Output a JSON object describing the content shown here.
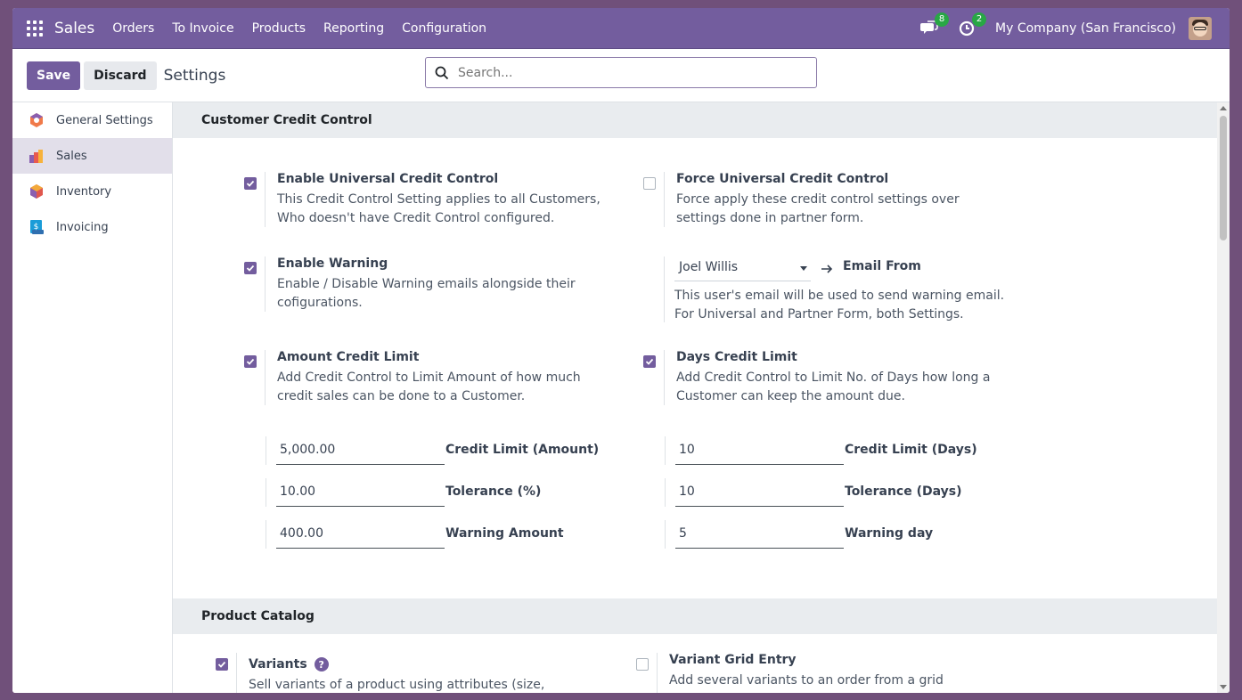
{
  "topnav": {
    "app_name": "Sales",
    "menu": [
      "Orders",
      "To Invoice",
      "Products",
      "Reporting",
      "Configuration"
    ],
    "messages_count": "8",
    "activities_count": "2",
    "company": "My Company (San Francisco)",
    "icons": [
      "apps-grid-icon",
      "chat-icon",
      "clock-icon",
      "avatar"
    ]
  },
  "control_panel": {
    "save_label": "Save",
    "discard_label": "Discard",
    "title": "Settings",
    "search_placeholder": "Search..."
  },
  "sidebar": {
    "items": [
      {
        "label": "General Settings",
        "active": false
      },
      {
        "label": "Sales",
        "active": true
      },
      {
        "label": "Inventory",
        "active": false
      },
      {
        "label": "Invoicing",
        "active": false
      }
    ]
  },
  "credit_section": {
    "title": "Customer Credit Control",
    "universal": {
      "label": "Enable Universal Credit Control",
      "desc": "This Credit Control Setting applies to all Customers, Who doesn't have Credit Control configured.",
      "checked": true
    },
    "force": {
      "label": "Force Universal Credit Control",
      "desc": "Force apply these credit control settings over settings done in partner form.",
      "checked": false
    },
    "warning": {
      "label": "Enable Warning",
      "desc": "Enable / Disable Warning emails alongside their cofigurations.",
      "checked": true
    },
    "email_from": {
      "user": "Joel Willis",
      "label": "Email From",
      "desc": "This user's email will be used to send warning email. For Universal and Partner Form, both Settings."
    },
    "amount_limit": {
      "label": "Amount Credit Limit",
      "desc": "Add Credit Control to Limit Amount of how much credit sales can be done to a Customer.",
      "checked": true
    },
    "days_limit": {
      "label": "Days Credit Limit",
      "desc": "Add Credit Control to Limit No. of Days how long a Customer can keep the amount due.",
      "checked": true
    },
    "amount_fields": [
      {
        "value": "5,000.00",
        "label": "Credit Limit (Amount)"
      },
      {
        "value": "10.00",
        "label": "Tolerance (%)"
      },
      {
        "value": "400.00",
        "label": "Warning Amount"
      }
    ],
    "days_fields": [
      {
        "value": "10",
        "label": "Credit Limit (Days)"
      },
      {
        "value": "10",
        "label": "Tolerance (Days)"
      },
      {
        "value": "5",
        "label": "Warning day"
      }
    ]
  },
  "catalog_section": {
    "title": "Product Catalog",
    "variants": {
      "label": "Variants",
      "desc": "Sell variants of a product using attributes (size, color, etc.)",
      "checked": true
    },
    "grid": {
      "label": "Variant Grid Entry",
      "desc": "Add several variants to an order from a grid",
      "checked": false
    }
  },
  "colors": {
    "primary": "#735d9e",
    "badge": "#28a745",
    "section_bg": "#e9ecef",
    "active_sidebar": "#e2dfea"
  }
}
